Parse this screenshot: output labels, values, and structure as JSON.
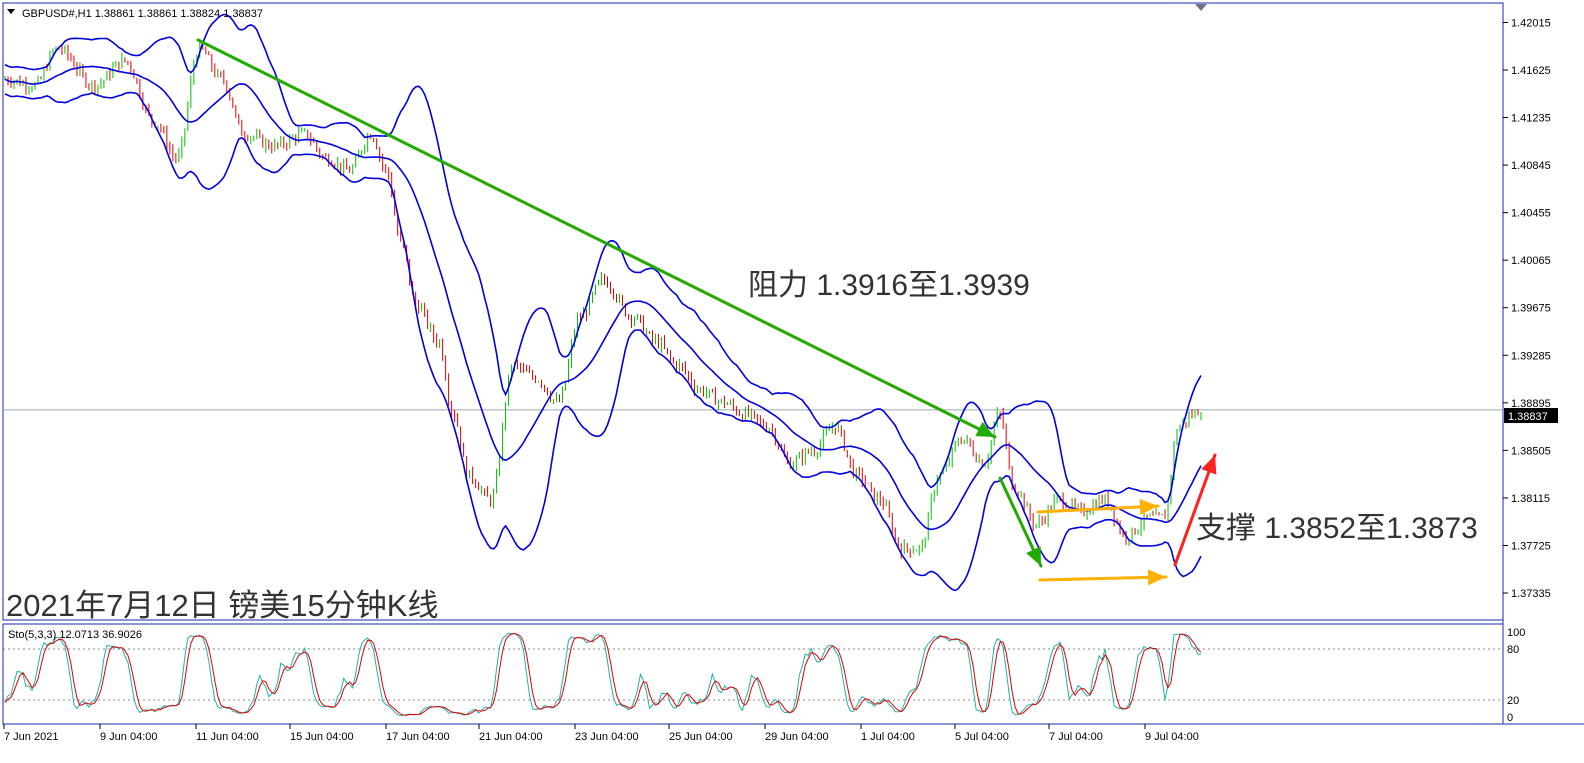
{
  "header": {
    "symbol_info": "GBPUSD#,H1  1.38861 1.38861 1.38824 1.38837"
  },
  "indicator": {
    "label": "Sto(5,3,3) 12.0713 36.9026",
    "levels": [
      "100",
      "80",
      "20",
      "0"
    ]
  },
  "price_axis": {
    "ticks": [
      "1.42015",
      "1.41625",
      "1.41235",
      "1.40845",
      "1.40455",
      "1.40065",
      "1.39675",
      "1.39285",
      "1.38895",
      "1.38505",
      "1.38115",
      "1.37725",
      "1.37335"
    ],
    "current_price": "1.38837"
  },
  "time_axis": {
    "ticks": [
      "7 Jun 2021",
      "9 Jun 04:00",
      "11 Jun 04:00",
      "15 Jun 04:00",
      "17 Jun 04:00",
      "21 Jun 04:00",
      "23 Jun 04:00",
      "25 Jun 04:00",
      "29 Jun 04:00",
      "1 Jul 04:00",
      "5 Jul 04:00",
      "7 Jul 04:00",
      "9 Jul 04:00"
    ]
  },
  "annotations": {
    "resistance": "阻力 1.3916至1.3939",
    "support": "支撑 1.3852至1.3873",
    "caption": "2021年7月12日 镑美15分钟K线"
  },
  "colors": {
    "bands": "#0000e0",
    "bull_candle": "#00c000",
    "bear_candle": "#e00000",
    "trend_arrow": "#22aa00",
    "range_arrow": "#ffb000",
    "up_arrow": "#ff2020",
    "stoch_main": "#20b2aa",
    "stoch_signal": "#e00000",
    "price_line": "#9aa6b8"
  },
  "chart_data": {
    "type": "candlestick",
    "symbol": "GBPUSD#",
    "timeframe": "H1",
    "ylim": [
      1.3713,
      1.4215
    ],
    "current_price": 1.38837,
    "anchors": [
      {
        "t": 0.0,
        "p": 1.4155
      },
      {
        "t": 0.02,
        "p": 1.415
      },
      {
        "t": 0.035,
        "p": 1.418
      },
      {
        "t": 0.06,
        "p": 1.415
      },
      {
        "t": 0.08,
        "p": 1.417
      },
      {
        "t": 0.1,
        "p": 1.412
      },
      {
        "t": 0.115,
        "p": 1.409
      },
      {
        "t": 0.13,
        "p": 1.418
      },
      {
        "t": 0.145,
        "p": 1.4155
      },
      {
        "t": 0.16,
        "p": 1.411
      },
      {
        "t": 0.18,
        "p": 1.41
      },
      {
        "t": 0.2,
        "p": 1.411
      },
      {
        "t": 0.215,
        "p": 1.409
      },
      {
        "t": 0.23,
        "p": 1.408
      },
      {
        "t": 0.245,
        "p": 1.411
      },
      {
        "t": 0.255,
        "p": 1.408
      },
      {
        "t": 0.265,
        "p": 1.402
      },
      {
        "t": 0.275,
        "p": 1.397
      },
      {
        "t": 0.29,
        "p": 1.394
      },
      {
        "t": 0.3,
        "p": 1.388
      },
      {
        "t": 0.31,
        "p": 1.383
      },
      {
        "t": 0.325,
        "p": 1.381
      },
      {
        "t": 0.34,
        "p": 1.392
      },
      {
        "t": 0.355,
        "p": 1.391
      },
      {
        "t": 0.37,
        "p": 1.389
      },
      {
        "t": 0.385,
        "p": 1.396
      },
      {
        "t": 0.4,
        "p": 1.399
      },
      {
        "t": 0.42,
        "p": 1.396
      },
      {
        "t": 0.435,
        "p": 1.394
      },
      {
        "t": 0.45,
        "p": 1.392
      },
      {
        "t": 0.465,
        "p": 1.39
      },
      {
        "t": 0.48,
        "p": 1.389
      },
      {
        "t": 0.495,
        "p": 1.388
      },
      {
        "t": 0.51,
        "p": 1.387
      },
      {
        "t": 0.525,
        "p": 1.384
      },
      {
        "t": 0.54,
        "p": 1.385
      },
      {
        "t": 0.555,
        "p": 1.387
      },
      {
        "t": 0.57,
        "p": 1.383
      },
      {
        "t": 0.585,
        "p": 1.381
      },
      {
        "t": 0.6,
        "p": 1.377
      },
      {
        "t": 0.612,
        "p": 1.377
      },
      {
        "t": 0.625,
        "p": 1.383
      },
      {
        "t": 0.64,
        "p": 1.386
      },
      {
        "t": 0.655,
        "p": 1.384
      },
      {
        "t": 0.665,
        "p": 1.388
      },
      {
        "t": 0.675,
        "p": 1.382
      },
      {
        "t": 0.69,
        "p": 1.379
      },
      {
        "t": 0.705,
        "p": 1.381
      },
      {
        "t": 0.72,
        "p": 1.38
      },
      {
        "t": 0.735,
        "p": 1.381
      },
      {
        "t": 0.75,
        "p": 1.378
      },
      {
        "t": 0.765,
        "p": 1.3795
      },
      {
        "t": 0.775,
        "p": 1.3795
      },
      {
        "t": 0.785,
        "p": 1.387
      },
      {
        "t": 0.795,
        "p": 1.388
      },
      {
        "t": 0.8,
        "p": 1.3884
      }
    ]
  }
}
